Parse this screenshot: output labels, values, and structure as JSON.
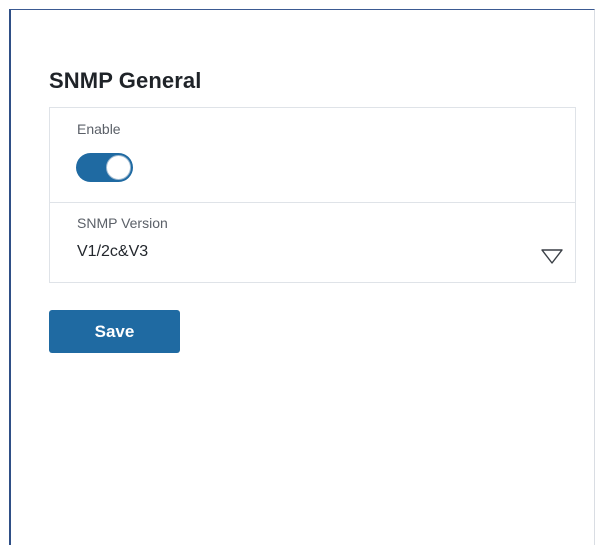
{
  "panel": {
    "title": "SNMP General"
  },
  "enable": {
    "label": "Enable",
    "state": "on"
  },
  "snmp_version": {
    "label": "SNMP Version",
    "value": "V1/2c&V3"
  },
  "actions": {
    "save_label": "Save"
  },
  "colors": {
    "accent": "#1f6aa2",
    "frame_border": "#2f4f86",
    "title_text": "#1f2328",
    "label_text": "#5b6068"
  },
  "icons": {
    "dropdown": "chevron-down-icon"
  }
}
